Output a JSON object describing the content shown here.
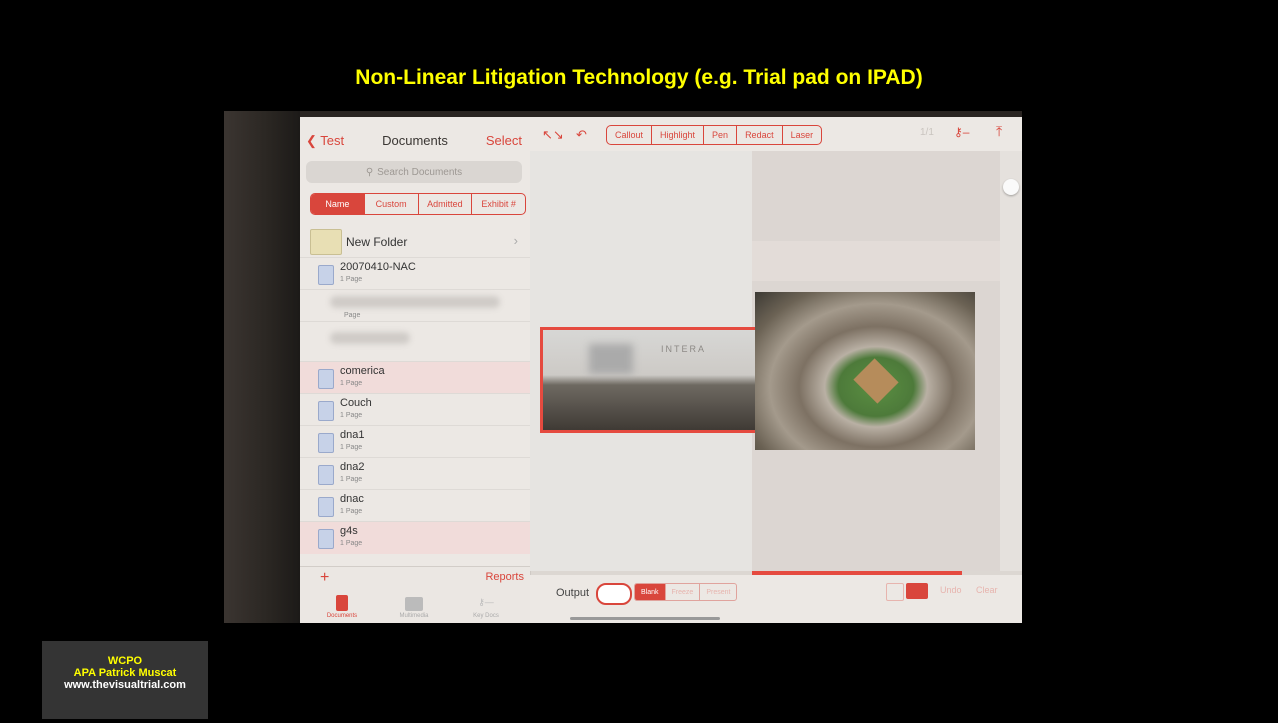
{
  "slide": {
    "title": "Non-Linear Litigation Technology (e.g. Trial pad on IPAD)",
    "credit": {
      "line1": "WCPO",
      "line2": "APA Patrick Muscat",
      "line3": "www.thevisualtrial.com"
    }
  },
  "ipad": {
    "sidebar": {
      "back_label": "Test",
      "title": "Documents",
      "select_label": "Select",
      "search_placeholder": "Search Documents",
      "sort_tabs": [
        {
          "label": "Name",
          "active": true
        },
        {
          "label": "Custom",
          "active": false
        },
        {
          "label": "Admitted",
          "active": false
        },
        {
          "label": "Exhibit #",
          "active": false
        }
      ],
      "folder": {
        "label": "New Folder"
      },
      "documents": [
        {
          "name": "20070410-NAC",
          "pages": "1 Page",
          "highlighted": false
        },
        {
          "name": "comerica",
          "pages": "1 Page",
          "highlighted": true
        },
        {
          "name": "Couch",
          "pages": "1 Page",
          "highlighted": false
        },
        {
          "name": "dna1",
          "pages": "1 Page",
          "highlighted": false
        },
        {
          "name": "dna2",
          "pages": "1 Page",
          "highlighted": false
        },
        {
          "name": "dnac",
          "pages": "1 Page",
          "highlighted": false
        },
        {
          "name": "g4s",
          "pages": "1 Page",
          "highlighted": true
        }
      ],
      "blurred_page_label": "Page",
      "add_label": "+",
      "reports_label": "Reports",
      "bottom_tabs": [
        {
          "label": "Documents"
        },
        {
          "label": "Multimedia"
        },
        {
          "label": "Key Docs"
        }
      ]
    },
    "toolbar": {
      "tools": [
        "Callout",
        "Highlight",
        "Pen",
        "Redact",
        "Laser"
      ],
      "page_indicator": "1/1",
      "key_icon": "key-icon",
      "share_icon": "share-icon"
    },
    "viewer": {
      "callout_engraving": "INTERA"
    },
    "bottom_bar": {
      "output_label": "Output",
      "modes": [
        {
          "label": "Blank",
          "active": true
        },
        {
          "label": "Freeze",
          "active": false
        },
        {
          "label": "Present",
          "active": false
        }
      ],
      "undo_label": "Undo",
      "clear_label": "Clear"
    },
    "colors": {
      "accent": "#d9463c"
    }
  }
}
